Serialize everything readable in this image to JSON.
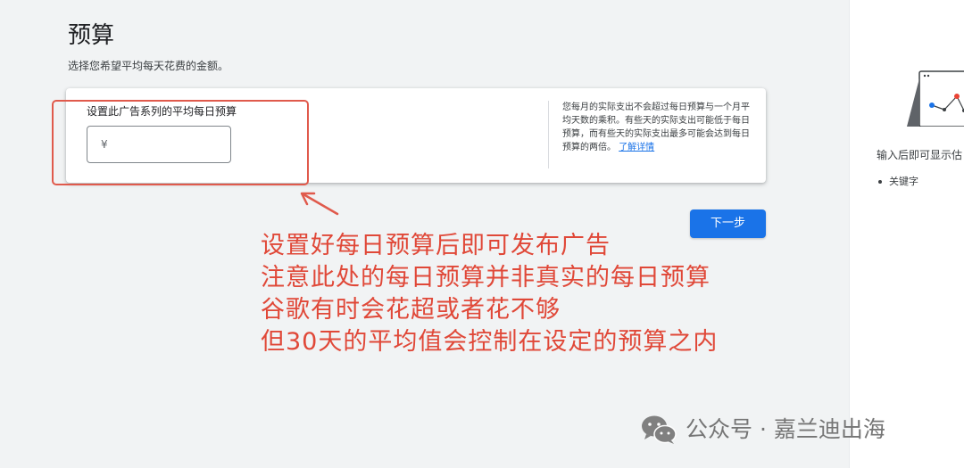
{
  "page": {
    "title": "预算",
    "subtitle": "选择您希望平均每天花费的金额。"
  },
  "budget_card": {
    "field_label": "设置此广告系列的平均每日预算",
    "currency_symbol": "¥",
    "input_value": "",
    "help_text": "您每月的实际支出不会超过每日预算与一个月平均天数的乘积。有些天的实际支出可能低于每日预算，而有些天的实际支出最多可能会达到每日预算的两倍。",
    "help_link": "了解详情"
  },
  "next_button": {
    "label": "下一步"
  },
  "annotation": {
    "lines": [
      "设置好每日预算后即可发布广告",
      "注意此处的每日预算并非真实的每日预算",
      "谷歌有时会花超或者花不够",
      "但30天的平均值会控制在设定的预算之内"
    ],
    "color": "#e04838"
  },
  "right_panel": {
    "text": "输入后即可显示估",
    "bullet": "关键字"
  },
  "watermark": {
    "text": "公众号 · 嘉兰迪出海"
  },
  "colors": {
    "primary": "#1a73e8",
    "background": "#f1f3f4"
  }
}
